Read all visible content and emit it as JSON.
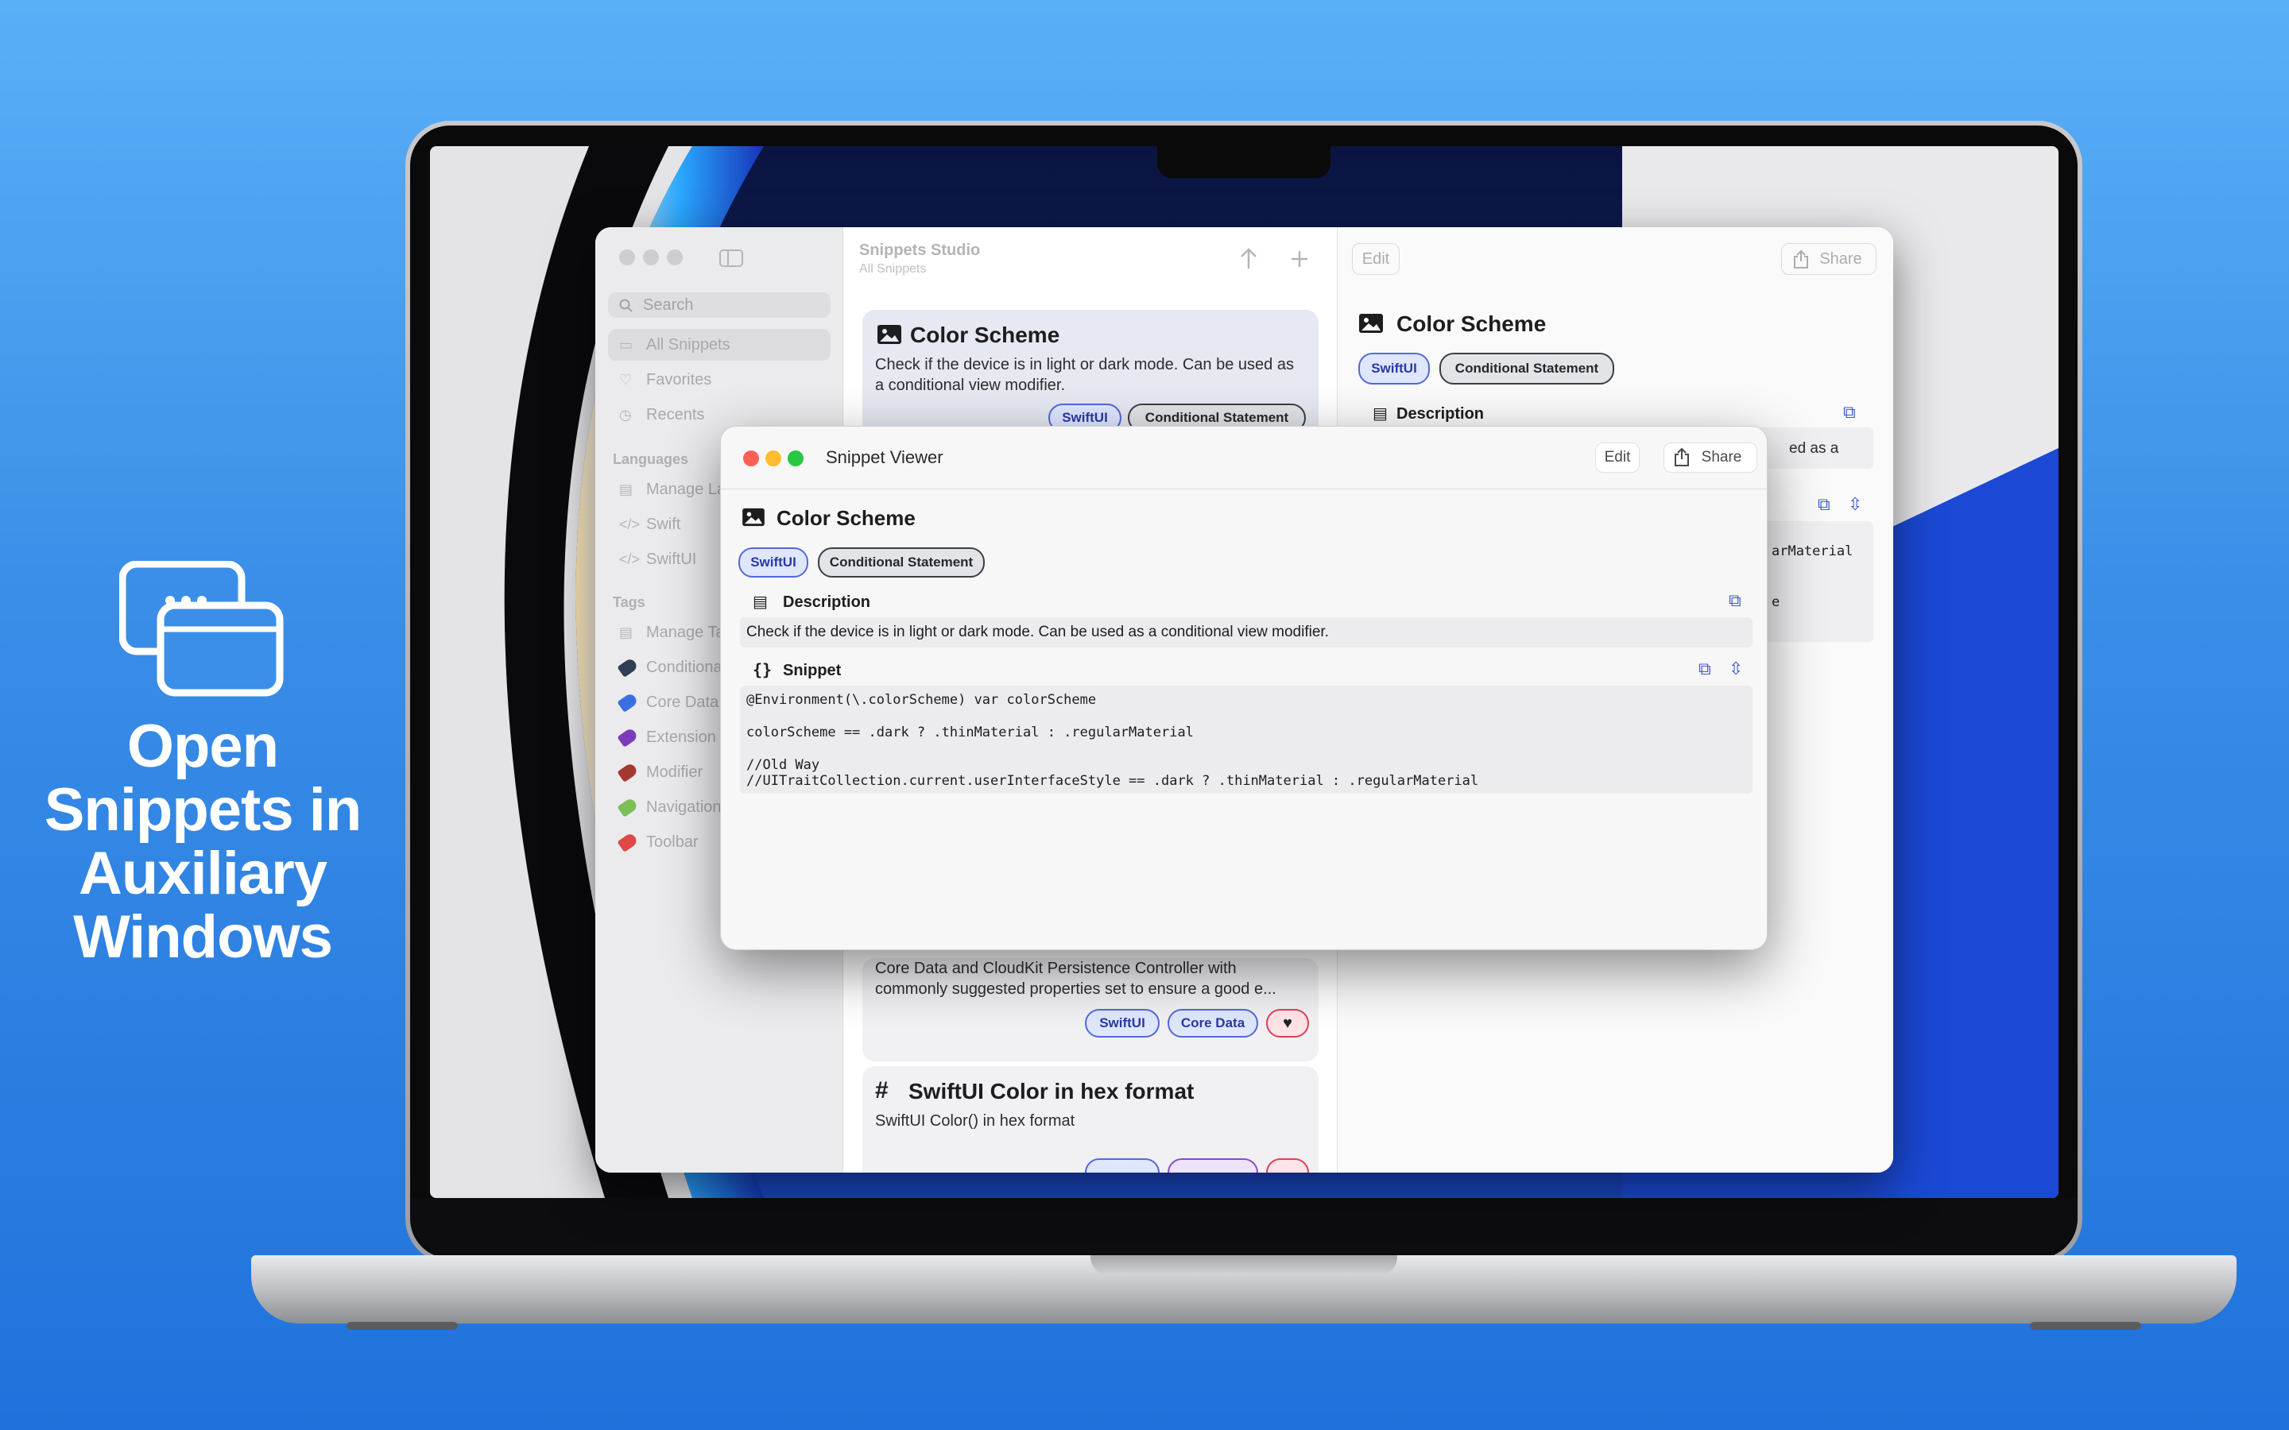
{
  "promo": {
    "line1": "Open",
    "line2": "Snippets in",
    "line3": "Auxiliary",
    "line4": "Windows",
    "icon": "windows-stack-icon"
  },
  "colors": {
    "background": "#3b8fe8",
    "accent": "#3e5bd6",
    "tag_blue": "#5468d8",
    "tag_heart": "#e23d58"
  },
  "main_window": {
    "toolbar": {
      "title": "Snippets Studio",
      "subtitle": "All Snippets",
      "edit": "Edit",
      "share": "Share"
    },
    "sidebar": {
      "search_placeholder": "Search",
      "library": [
        {
          "label": "All Snippets",
          "icon": "folder-icon"
        },
        {
          "label": "Favorites",
          "icon": "heart-icon"
        },
        {
          "label": "Recents",
          "icon": "clock-icon"
        }
      ],
      "languages_header": "Languages",
      "languages": [
        {
          "label": "Manage Languages",
          "icon": "manage-icon"
        },
        {
          "label": "Swift",
          "icon": "code-icon"
        },
        {
          "label": "SwiftUI",
          "icon": "code-icon"
        }
      ],
      "tags_header": "Tags",
      "tags": [
        {
          "label": "Manage Tags",
          "color": "#b9c4dd"
        },
        {
          "label": "Conditional Statement",
          "color": "#2f3e52"
        },
        {
          "label": "Core Data",
          "color": "#3b6ee0"
        },
        {
          "label": "Extension",
          "color": "#7c3bb8"
        },
        {
          "label": "Modifier",
          "color": "#a6372f"
        },
        {
          "label": "Navigation",
          "color": "#7dbf55"
        },
        {
          "label": "Toolbar",
          "color": "#e04848"
        }
      ]
    },
    "cards": [
      {
        "title": "Color Scheme",
        "icon": "photo-icon",
        "desc": "Check if the device is in light or dark mode. Can be used as a conditional view modifier.",
        "tags": [
          "SwiftUI",
          "Conditional Statement"
        ]
      },
      {
        "title": "",
        "desc": "Core Data and CloudKit Persistence Controller with commonly suggested properties set to ensure a good e...",
        "tags": [
          "SwiftUI",
          "Core Data"
        ],
        "favorite": true
      },
      {
        "title": "SwiftUI Color in hex format",
        "icon": "hash-icon",
        "desc": "SwiftUI Color() in hex format",
        "tags": []
      }
    ],
    "detail": {
      "title": "Color Scheme",
      "tags": [
        "SwiftUI",
        "Conditional Statement"
      ],
      "description_label": "Description",
      "peek_desc": "ed as a",
      "peek_code1": "arMaterial",
      "peek_code2": "e"
    }
  },
  "viewer": {
    "window_title": "Snippet Viewer",
    "edit": "Edit",
    "share": "Share",
    "title": "Color Scheme",
    "tags": [
      "SwiftUI",
      "Conditional Statement"
    ],
    "description_label": "Description",
    "description": "Check if the device is in light or dark mode. Can be used as a conditional view modifier.",
    "snippet_label": "Snippet",
    "code_lines": [
      "@Environment(\\.colorScheme) var colorScheme",
      "",
      "colorScheme == .dark ? .thinMaterial : .regularMaterial",
      "",
      "//Old Way",
      "//UITraitCollection.current.userInterfaceStyle == .dark ? .thinMaterial : .regularMaterial"
    ]
  }
}
